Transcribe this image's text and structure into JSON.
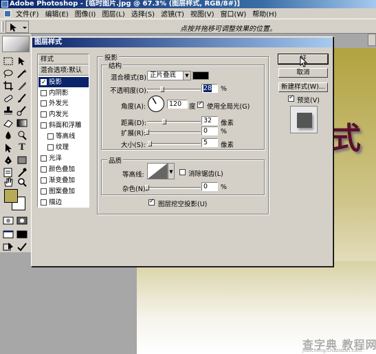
{
  "window": {
    "title": "Adobe Photoshop - [临时图片.jpg @ 67.3% (图层样式, RGB/8#)]"
  },
  "menu": [
    "文件(F)",
    "编辑(E)",
    "图像(I)",
    "图层(L)",
    "选择(S)",
    "滤镜(T)",
    "视图(V)",
    "窗口(W)",
    "帮助(H)"
  ],
  "options_bar": {
    "hint": "点按并拖移可调整效果的位置。"
  },
  "toolbox": {
    "tools": [
      "marquee",
      "move",
      "lasso",
      "magic-wand",
      "crop",
      "slice",
      "healing",
      "brush",
      "stamp",
      "history-brush",
      "eraser",
      "gradient",
      "dodge",
      "path",
      "path-select",
      "type",
      "pen",
      "shape",
      "notes",
      "eyedropper",
      "hand",
      "zoom"
    ],
    "foreground_color": "#b9aa5a",
    "background_color": "#ffffff"
  },
  "dialog": {
    "title": "图层样式",
    "styles_header": "样式",
    "blend_options": "混合选项:默认",
    "styles": [
      {
        "label": "投影",
        "checked": true,
        "selected": true
      },
      {
        "label": "内阴影",
        "checked": false
      },
      {
        "label": "外发光",
        "checked": false
      },
      {
        "label": "内发光",
        "checked": false
      },
      {
        "label": "斜面和浮雕",
        "checked": false
      },
      {
        "label": "等高线",
        "checked": false,
        "indent": true
      },
      {
        "label": "纹理",
        "checked": false,
        "indent": true
      },
      {
        "label": "光泽",
        "checked": false
      },
      {
        "label": "颜色叠加",
        "checked": false
      },
      {
        "label": "渐变叠加",
        "checked": false
      },
      {
        "label": "图案叠加",
        "checked": false
      },
      {
        "label": "描边",
        "checked": false
      }
    ],
    "panel_title": "投影",
    "structure": {
      "title": "结构",
      "blend_mode_label": "混合模式(B):",
      "blend_mode_value": "正片叠底",
      "blend_color": "#000000",
      "opacity_label": "不透明度(O):",
      "opacity_value": "28",
      "opacity_unit": "%",
      "angle_label": "角度(A):",
      "angle_value": "120",
      "angle_unit": "度",
      "global_light_label": "使用全局光(G)",
      "global_light_checked": true,
      "distance_label": "距离(D):",
      "distance_value": "32",
      "distance_unit": "像素",
      "spread_label": "扩展(R):",
      "spread_value": "0",
      "spread_unit": "%",
      "size_label": "大小(S):",
      "size_value": "5",
      "size_unit": "像素"
    },
    "quality": {
      "title": "品质",
      "contour_label": "等高线:",
      "antialias_label": "消除锯齿(L)",
      "antialias_checked": false,
      "noise_label": "杂色(N):",
      "noise_value": "0",
      "noise_unit": "%"
    },
    "knockout_label": "图层挖空投影(U)",
    "knockout_checked": true,
    "buttons": {
      "ok": "好",
      "cancel": "取消",
      "new_style": "新建样式(W)..."
    },
    "preview_label": "预览(V)",
    "preview_checked": true
  },
  "watermark": {
    "text": "查字典 教程网",
    "url": "jiaocheng.chazidian.com"
  }
}
